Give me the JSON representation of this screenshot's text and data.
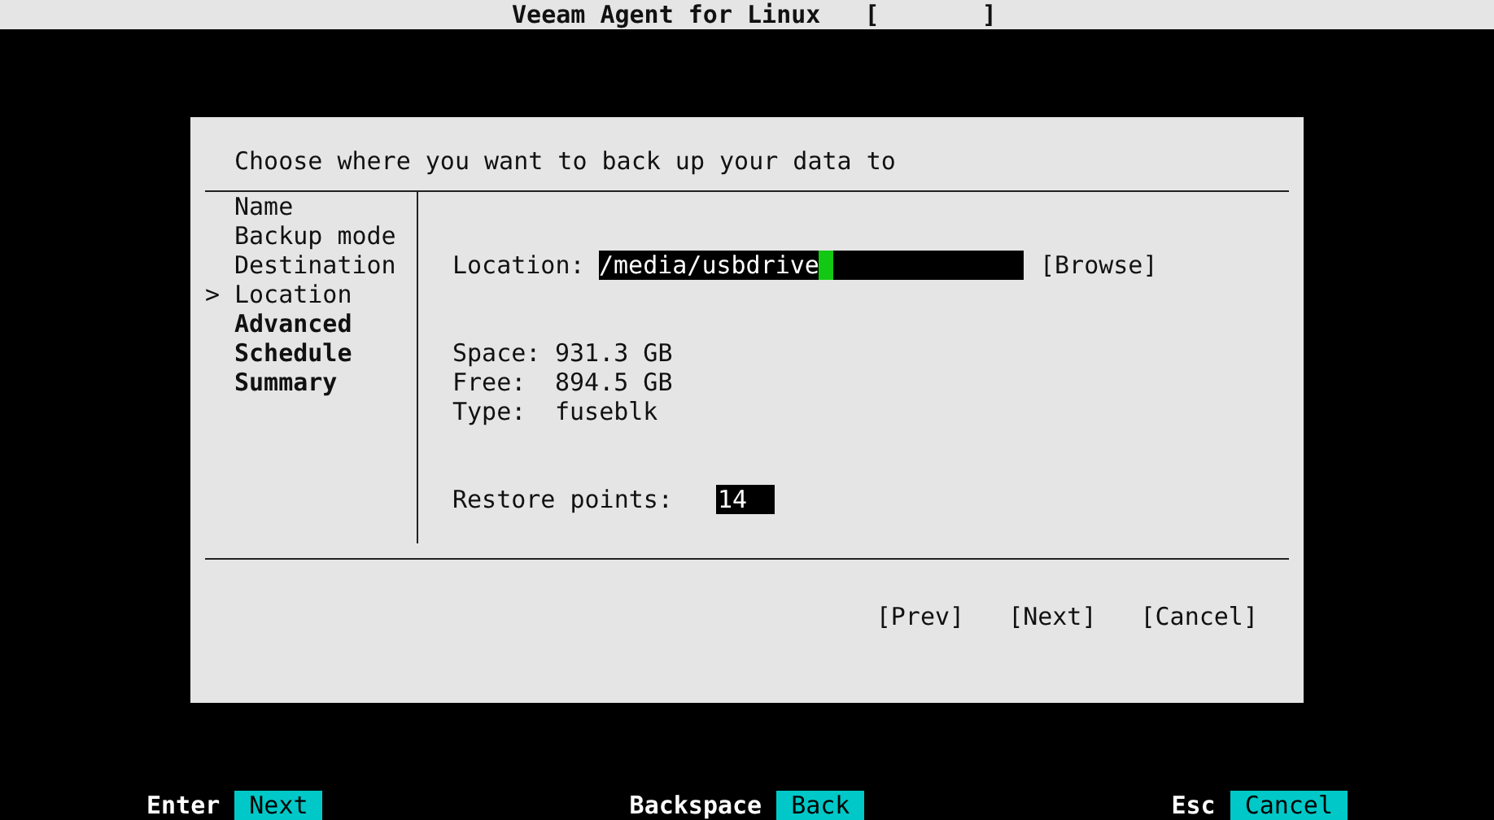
{
  "title_bar": {
    "title": "Veeam Agent for Linux",
    "status": "[       ]"
  },
  "dialog": {
    "heading": "Choose where you want to back up your data to",
    "steps": {
      "marker": ">",
      "items": [
        {
          "label": "Name",
          "selected": false,
          "pending": false
        },
        {
          "label": "Backup mode",
          "selected": false,
          "pending": false
        },
        {
          "label": "Destination",
          "selected": false,
          "pending": false
        },
        {
          "label": "Location",
          "selected": true,
          "pending": false
        },
        {
          "label": "Advanced",
          "selected": false,
          "pending": true
        },
        {
          "label": "Schedule",
          "selected": false,
          "pending": true
        },
        {
          "label": "Summary",
          "selected": false,
          "pending": true
        }
      ]
    },
    "location": {
      "label": "Location:",
      "value": "/media/usbdrive",
      "browse": "[Browse]"
    },
    "info": [
      {
        "label": "Space:",
        "value": "931.3 GB"
      },
      {
        "label": "Free:",
        "value": "894.5 GB"
      },
      {
        "label": "Type:",
        "value": "fuseblk"
      }
    ],
    "restore_points": {
      "label": "Restore points:",
      "value": "14"
    },
    "buttons": [
      "[Prev]",
      "[Next]",
      "[Cancel]"
    ]
  },
  "key_bar": [
    {
      "key": "Enter",
      "action": "Next"
    },
    {
      "key": "Backspace",
      "action": "Back"
    },
    {
      "key": "Esc",
      "action": "Cancel"
    }
  ]
}
